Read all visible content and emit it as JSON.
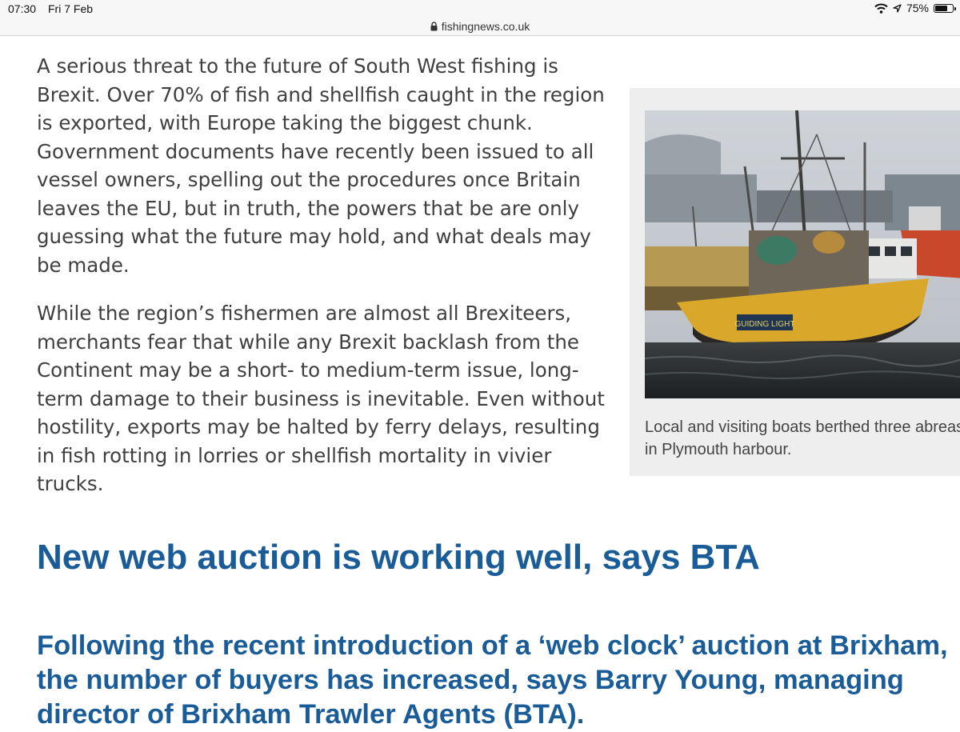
{
  "status_bar": {
    "time": "07:30",
    "date": "Fri 7 Feb",
    "battery_percent": "75%",
    "battery_level": 0.75
  },
  "url_bar": {
    "domain": "fishingnews.co.uk",
    "icon": "lock-icon"
  },
  "article": {
    "paragraphs": [
      "A serious threat to the future of South West fishing is Brexit. Over 70% of fish and shellfish caught in the region is exported, with Europe taking the biggest chunk. Government documents have recently been issued to all vessel owners, spelling out the procedures once Britain leaves the EU, but in truth, the powers that be are only guessing what the future may hold, and what deals may be made.",
      "While the region’s fishermen are almost all Brexiteers, merchants fear that while any Brexit backlash from the Continent may be a short- to medium-term issue, long-term damage to their business is inevitable. Even without hostility, exports may be halted by ferry delays, resulting in fish rotting in lorries or shellfish mortality in vivier trucks."
    ],
    "figure": {
      "caption": "Local and visiting boats berthed three abreast in Plymouth harbour.",
      "boat_name": "GUIDING LIGHT"
    },
    "heading": "New web auction is working well, says BTA",
    "lead": "Following the recent introduction of a ‘web clock’ auction at Brixham, the number of buyers has increased, says Barry Young, managing director of Brixham Trawler Agents (BTA)."
  },
  "colors": {
    "heading": "#1a5c98",
    "body_text": "#3f3f3f",
    "figure_bg": "#eeeeee"
  }
}
